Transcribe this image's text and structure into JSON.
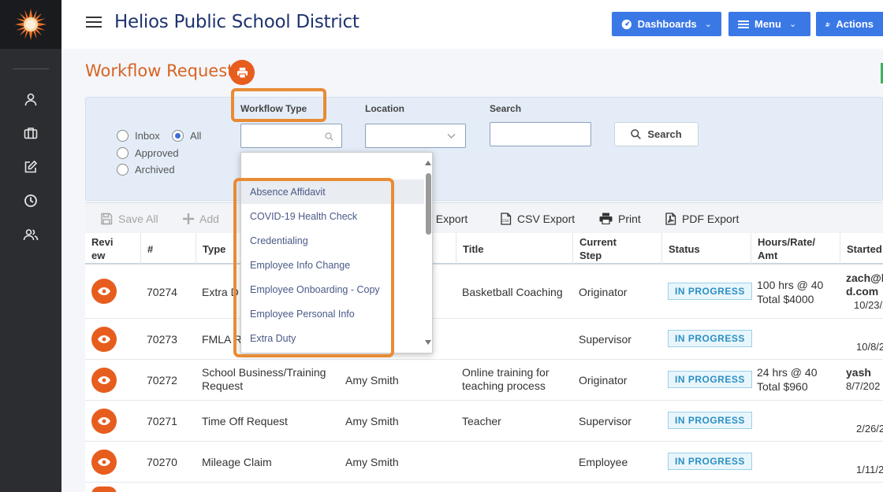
{
  "header": {
    "title": "Helios Public School District",
    "buttons": {
      "dashboards": "Dashboards",
      "menu": "Menu",
      "actions": "Actions"
    }
  },
  "sidebar": {
    "icons": [
      "user-icon",
      "briefcase-icon",
      "edit-icon",
      "clock-icon",
      "users-icon"
    ]
  },
  "page": {
    "title": "Workflow Requests"
  },
  "filters": {
    "radios": {
      "inbox": "Inbox",
      "all": "All",
      "approved": "Approved",
      "archived": "Archived",
      "selected": "All"
    },
    "workflow_type_label": "Workflow Type",
    "location_label": "Location",
    "search_label": "Search",
    "search_button": "Search"
  },
  "dropdown": {
    "items": [
      "Absence Affidavit",
      "COVID-19 Health Check",
      "Credentialing",
      "Employee Info Change",
      "Employee Onboarding - Copy",
      "Employee Personal Info",
      "Extra Duty"
    ],
    "active": "Absence Affidavit"
  },
  "toolbar": {
    "save_all": "Save All",
    "add": "Add",
    "excel_export": "el Export",
    "csv_export": "CSV Export",
    "print": "Print",
    "pdf_export": "PDF Export"
  },
  "table": {
    "headers": {
      "review": "Revi\new",
      "number": "#",
      "type": "Type",
      "title": "Title",
      "current_step": "Current\nStep",
      "status": "Status",
      "hours": "Hours/Rate/\nAmt",
      "started": "Started"
    },
    "rows": [
      {
        "number": "70274",
        "type": "Extra D",
        "requester": "",
        "title": "Basketball Coaching",
        "step": "Originator",
        "status": "IN PROGRESS",
        "hours_1": "100 hrs @ 40",
        "hours_2": "Total $4000",
        "started_1": "zach@l",
        "started_2": "d.com",
        "started_3": "10/23/2"
      },
      {
        "number": "70273",
        "type": "FMLA R",
        "requester": "",
        "title": "",
        "step": "Supervisor",
        "status": "IN PROGRESS",
        "hours_1": "",
        "hours_2": "",
        "started_1": "",
        "started_2": "",
        "started_3": "10/8/20"
      },
      {
        "number": "70272",
        "type": "School Business/Training\nRequest",
        "requester": "Amy Smith",
        "title": "Online training for\nteaching process",
        "step": "Originator",
        "status": "IN PROGRESS",
        "hours_1": "24 hrs @ 40",
        "hours_2": "Total $960",
        "started_1": "yash",
        "started_2": "",
        "started_3": "8/7/202"
      },
      {
        "number": "70271",
        "type": "Time Off Request",
        "requester": "Amy Smith",
        "title": "Teacher",
        "step": "Supervisor",
        "status": "IN PROGRESS",
        "hours_1": "",
        "hours_2": "",
        "started_1": "",
        "started_2": "",
        "started_3": "2/26/20"
      },
      {
        "number": "70270",
        "type": "Mileage Claim",
        "requester": "Amy Smith",
        "title": "",
        "step": "Employee",
        "status": "IN PROGRESS",
        "hours_1": "",
        "hours_2": "",
        "started_1": "",
        "started_2": "",
        "started_3": "1/11/20"
      }
    ]
  },
  "colors": {
    "accent_orange": "#e75d1e",
    "brand_blue": "#1f3470",
    "button_blue": "#3a78e6",
    "highlight": "#e88b35",
    "status_blue": "#2c8fc2"
  }
}
